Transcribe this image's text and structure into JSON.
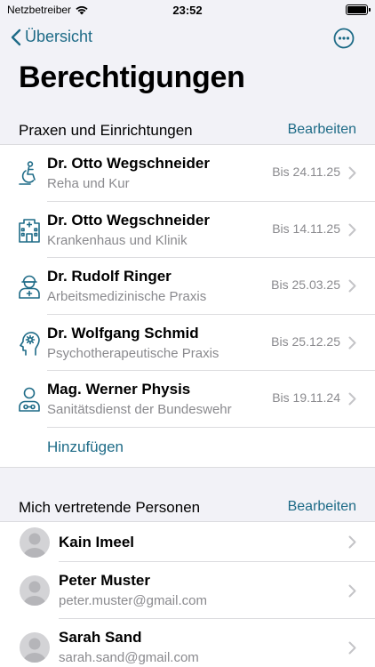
{
  "status_bar": {
    "carrier": "Netzbetreiber",
    "time": "23:52"
  },
  "nav": {
    "back_label": "Übersicht"
  },
  "page": {
    "title": "Berechtigungen"
  },
  "section_practices": {
    "title": "Praxen und Einrichtungen",
    "edit_label": "Bearbeiten",
    "items": [
      {
        "name": "Dr. Otto Wegschneider",
        "subtitle": "Reha und Kur",
        "date": "Bis 24.11.25",
        "icon": "rehab-icon"
      },
      {
        "name": "Dr. Otto Wegschneider",
        "subtitle": "Krankenhaus und Klinik",
        "date": "Bis 14.11.25",
        "icon": "hospital-icon"
      },
      {
        "name": "Dr. Rudolf Ringer",
        "subtitle": "Arbeitsmedizinische Praxis",
        "date": "Bis 25.03.25",
        "icon": "occupational-doctor-icon"
      },
      {
        "name": "Dr. Wolfgang Schmid",
        "subtitle": "Psychotherapeutische Praxis",
        "date": "Bis 25.12.25",
        "icon": "psychotherapy-icon"
      },
      {
        "name": "Mag. Werner Physis",
        "subtitle": "Sanitätsdienst der Bundeswehr",
        "date": "Bis 19.11.24",
        "icon": "medical-service-icon"
      }
    ],
    "add_label": "Hinzufügen"
  },
  "section_persons": {
    "title": "Mich vertretende Personen",
    "edit_label": "Bearbeiten",
    "items": [
      {
        "name": "Kain Imeel",
        "email": ""
      },
      {
        "name": "Peter Muster",
        "email": "peter.muster@gmail.com"
      },
      {
        "name": "Sarah Sand",
        "email": "sarah.sand@gmail.com"
      }
    ]
  },
  "colors": {
    "accent": "#1e6b87",
    "background": "#f2f2f7",
    "secondary_text": "#8a8a8e"
  }
}
